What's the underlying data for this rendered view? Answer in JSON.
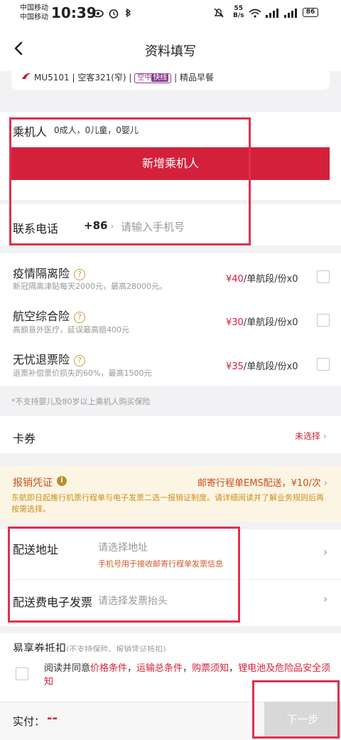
{
  "status_bar": {
    "carrier1": "中国移动",
    "carrier2": "中国移动",
    "time": "10:39",
    "speed_value": "55",
    "speed_unit": "B/s",
    "battery": "86"
  },
  "nav": {
    "title": "资料填写"
  },
  "flight": {
    "info": "MU5101 | 空客321(窄) |",
    "badge_left": "空中",
    "badge_right": "快线",
    "meal": "| 精品早餐"
  },
  "passenger": {
    "label": "乘机人",
    "counts": "0成人，0儿童，0婴儿",
    "add_button": "新增乘机人"
  },
  "contact": {
    "label": "联系电话",
    "code": "+86",
    "placeholder": "请输入手机号"
  },
  "insurance": [
    {
      "name": "疫情隔离险",
      "desc": "新冠隔离津贴每天2000元，最高28000元。",
      "price": "¥40",
      "unit": "/单航段/份x0"
    },
    {
      "name": "航空综合险",
      "desc": "高额意外医疗，延误最高赔400元",
      "price": "¥30",
      "unit": "/单航段/份x0"
    },
    {
      "name": "无忧退票险",
      "desc": "退票补偿票价损失的60%，最高1500元",
      "price": "¥35",
      "unit": "/单航段/份x0"
    }
  ],
  "insurance_note": "*不支持婴儿及80岁以上乘机人购买保险",
  "coupon": {
    "label": "卡券",
    "value": "未选择"
  },
  "invoice": {
    "label": "报销凭证",
    "value": "邮寄行程单EMS配送，¥10/次",
    "desc": "东航即日起推行机票行程单与电子发票二选一报销证制度。请详细阅读并了解业务规则后再按需选择。"
  },
  "delivery": {
    "address_label": "配送地址",
    "address_placeholder": "请选择地址",
    "address_note": "手机号用于接收邮寄行程单发票信息",
    "einvoice_label": "配送费电子发票",
    "einvoice_placeholder": "请选择发票抬头"
  },
  "partial_row": {
    "label": "易享券抵扣",
    "note": "(不支持保险、报销凭证抵扣)"
  },
  "agreement": {
    "prefix": "阅读并同意",
    "links": [
      "价格条件",
      "运输总条件",
      "购票须知",
      "锂电池及危险品安全须知"
    ],
    "separator": "，"
  },
  "footer": {
    "paid_label": "实付：",
    "amount": "--",
    "next_button": "下一步"
  },
  "colors": {
    "brand_red": "#d4213b",
    "annotation_red": "#e0304c",
    "invoice_bg": "#fdf5e4",
    "disabled_btn": "#d8d8d8"
  },
  "icons": [
    "back-arrow-icon",
    "eye-icon",
    "alarm-icon",
    "bluetooth-icon",
    "mute-icon",
    "wifi-icon",
    "signal-icon",
    "battery-icon",
    "airline-logo-icon",
    "question-icon",
    "info-icon",
    "chevron-right-icon"
  ]
}
